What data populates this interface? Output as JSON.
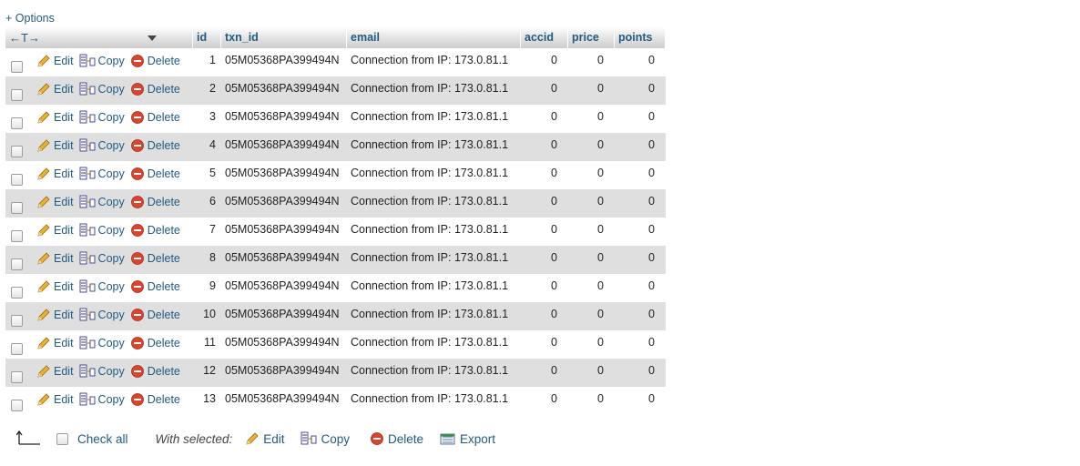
{
  "options_link": "+ Options",
  "columns": {
    "id": "id",
    "txn_id": "txn_id",
    "email": "email",
    "accid": "accid",
    "price": "price",
    "points": "points"
  },
  "actions": {
    "edit": "Edit",
    "copy": "Copy",
    "delete": "Delete"
  },
  "rows": [
    {
      "id": "1",
      "txn_id": "05M05368PA399494N",
      "email": "Connection from IP: 173.0.81.1",
      "accid": "0",
      "price": "0",
      "points": "0"
    },
    {
      "id": "2",
      "txn_id": "05M05368PA399494N",
      "email": "Connection from IP: 173.0.81.1",
      "accid": "0",
      "price": "0",
      "points": "0"
    },
    {
      "id": "3",
      "txn_id": "05M05368PA399494N",
      "email": "Connection from IP: 173.0.81.1",
      "accid": "0",
      "price": "0",
      "points": "0"
    },
    {
      "id": "4",
      "txn_id": "05M05368PA399494N",
      "email": "Connection from IP: 173.0.81.1",
      "accid": "0",
      "price": "0",
      "points": "0"
    },
    {
      "id": "5",
      "txn_id": "05M05368PA399494N",
      "email": "Connection from IP: 173.0.81.1",
      "accid": "0",
      "price": "0",
      "points": "0"
    },
    {
      "id": "6",
      "txn_id": "05M05368PA399494N",
      "email": "Connection from IP: 173.0.81.1",
      "accid": "0",
      "price": "0",
      "points": "0"
    },
    {
      "id": "7",
      "txn_id": "05M05368PA399494N",
      "email": "Connection from IP: 173.0.81.1",
      "accid": "0",
      "price": "0",
      "points": "0"
    },
    {
      "id": "8",
      "txn_id": "05M05368PA399494N",
      "email": "Connection from IP: 173.0.81.1",
      "accid": "0",
      "price": "0",
      "points": "0"
    },
    {
      "id": "9",
      "txn_id": "05M05368PA399494N",
      "email": "Connection from IP: 173.0.81.1",
      "accid": "0",
      "price": "0",
      "points": "0"
    },
    {
      "id": "10",
      "txn_id": "05M05368PA399494N",
      "email": "Connection from IP: 173.0.81.1",
      "accid": "0",
      "price": "0",
      "points": "0"
    },
    {
      "id": "11",
      "txn_id": "05M05368PA399494N",
      "email": "Connection from IP: 173.0.81.1",
      "accid": "0",
      "price": "0",
      "points": "0"
    },
    {
      "id": "12",
      "txn_id": "05M05368PA399494N",
      "email": "Connection from IP: 173.0.81.1",
      "accid": "0",
      "price": "0",
      "points": "0"
    },
    {
      "id": "13",
      "txn_id": "05M05368PA399494N",
      "email": "Connection from IP: 173.0.81.1",
      "accid": "0",
      "price": "0",
      "points": "0"
    }
  ],
  "footer": {
    "check_all": "Check all",
    "with_selected": "With selected:",
    "edit": "Edit",
    "copy": "Copy",
    "delete": "Delete",
    "export": "Export"
  },
  "icons": {
    "edit": "pencil-icon",
    "copy": "copy-icon",
    "delete": "delete-icon",
    "export": "export-icon",
    "arrow": "select-arrow-icon"
  },
  "colors": {
    "link": "#235a81",
    "row_alt": "#dfdfdf",
    "delete_red": "#d9452f",
    "pencil_yellow": "#e8b13a"
  }
}
